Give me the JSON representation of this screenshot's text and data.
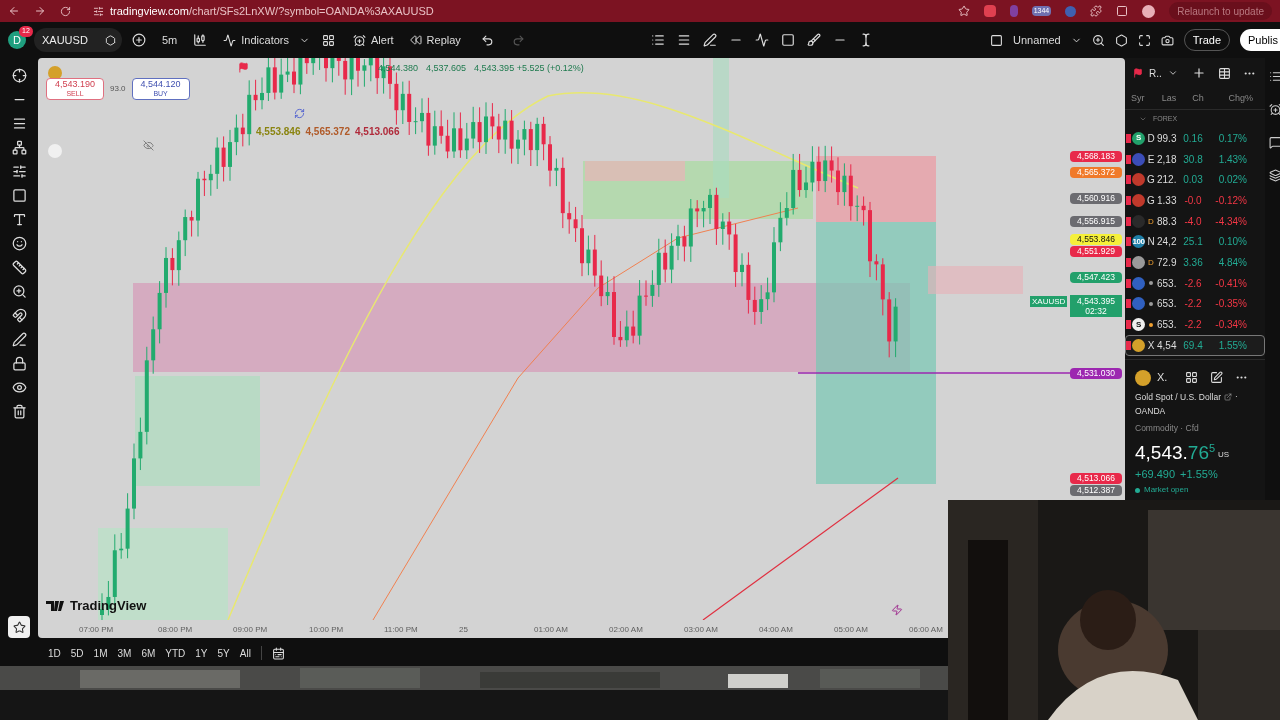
{
  "browser": {
    "url_host": "tradingview.com",
    "url_path": "/chart/SFs2LnXW/?symbol=OANDA%3AXAUUSD",
    "extension_badge": "1344",
    "relaunch": "Relaunch to update"
  },
  "toolbar": {
    "avatar": "D",
    "badge": "12",
    "symbol": "XAUUSD",
    "interval": "5m",
    "indicators": "Indicators",
    "alert": "Alert",
    "replay": "Replay",
    "layout": "Unnamed",
    "trade": "Trade",
    "publish": "Publis"
  },
  "chart": {
    "sell": {
      "price": "4,543.190",
      "label": "SELL"
    },
    "spread": "93.0",
    "buy": {
      "price": "4,544.120",
      "label": "BUY"
    },
    "ohlc": [
      "4,544.380",
      "4,537.605",
      "4,543.395 +5.525 (+0.12%)"
    ],
    "level_labels": [
      {
        "text": "4,553.846",
        "color": "#8a8410"
      },
      {
        "text": "4,565.372",
        "color": "#b05a28"
      },
      {
        "text": "4,513.066",
        "color": "#b02a3a"
      }
    ],
    "price_tags": [
      {
        "text": "4,568.183",
        "color": "#e8294a"
      },
      {
        "text": "4,565.372",
        "color": "#f07a2a"
      },
      {
        "text": "4,560.916",
        "color": "#6b6b70"
      },
      {
        "text": "4,556.915",
        "color": "#6b6b70"
      },
      {
        "text": "4,553.846",
        "color": "#f5f03a"
      },
      {
        "text": "4,551.929",
        "color": "#e8294a"
      },
      {
        "text": "4,547.423",
        "color": "#22a06b"
      },
      {
        "text": "4,531.030",
        "color": "#9c27b0"
      },
      {
        "text": "4,513.066",
        "color": "#e8294a"
      },
      {
        "text": "4,512.387",
        "color": "#6b6b70"
      }
    ],
    "current": {
      "symbol": "XAUUSD",
      "price": "4,543.395",
      "countdown": "02:32"
    },
    "time_axis": [
      "07:00 PM",
      "08:00 PM",
      "09:00 PM",
      "10:00 PM",
      "11:00 PM",
      "25",
      "01:00 AM",
      "02:00 AM",
      "03:00 AM",
      "04:00 AM",
      "05:00 AM",
      "06:00 AM"
    ],
    "watermark": "TradingView"
  },
  "ranges": [
    "1D",
    "5D",
    "1M",
    "3M",
    "6M",
    "YTD",
    "1Y",
    "5Y",
    "All"
  ],
  "watchlist": {
    "title": "R..",
    "columns": [
      "Syr",
      "Las",
      "Ch",
      "Chg%"
    ],
    "group": "FOREX",
    "rows": [
      {
        "icon_text": "S",
        "color": "#22a06b",
        "kind": "letter",
        "name": "D",
        "last": "99.3",
        "chg": "0.16",
        "chgp": "0.17%",
        "up": true,
        "selected": false
      },
      {
        "icon_text": "",
        "color": "#3b4db8",
        "kind": "letter",
        "name": "E",
        "last": "2,18",
        "chg": "30.8",
        "chgp": "1.43%",
        "up": true,
        "selected": false
      },
      {
        "icon_text": "",
        "color": "#c0392b",
        "kind": "letter",
        "name": "G",
        "last": "212.",
        "chg": "0.03",
        "chgp": "0.02%",
        "up": true,
        "selected": false
      },
      {
        "icon_text": "",
        "color": "#c0392b",
        "kind": "letter",
        "name": "G",
        "last": "1.33",
        "chg": "-0.0",
        "chgp": "-0.12%",
        "up": false,
        "selected": false
      },
      {
        "icon_text": "",
        "color": "#2a2a2a",
        "kind": "delayed",
        "name": "D",
        "last": "88.3",
        "chg": "-4.0",
        "chgp": "-4.34%",
        "up": false,
        "selected": false
      },
      {
        "icon_text": "100",
        "color": "#1f7fa8",
        "kind": "letter",
        "name": "N",
        "last": "24,2",
        "chg": "25.1",
        "chgp": "0.10%",
        "up": true,
        "selected": false
      },
      {
        "icon_text": "",
        "color": "#9a9a9a",
        "kind": "delayed",
        "name": "D",
        "last": "72.9",
        "chg": "3.36",
        "chgp": "4.84%",
        "up": true,
        "selected": false
      },
      {
        "icon_text": "",
        "color": "#3060c0",
        "kind": "dot",
        "marker": {
          "color": "#9a9a9a"
        },
        "last": "653.",
        "chg": "-2.6",
        "chgp": "-0.41%",
        "up": false,
        "selected": false
      },
      {
        "icon_text": "",
        "color": "#3060c0",
        "kind": "dot",
        "marker": {
          "color": "#9a9a9a"
        },
        "last": "653.",
        "chg": "-2.2",
        "chgp": "-0.35%",
        "up": false,
        "selected": false
      },
      {
        "icon_text": "S",
        "color": "#eeeeee",
        "kind": "dot",
        "marker": {
          "color": "#f0a030"
        },
        "last": "653.",
        "chg": "-2.2",
        "chgp": "-0.34%",
        "up": false,
        "selected": false
      },
      {
        "icon_text": "",
        "color": "#d4a02a",
        "kind": "letter",
        "name": "X",
        "last": "4,54",
        "chg": "69.4",
        "chgp": "1.55%",
        "up": true,
        "selected": true
      }
    ]
  },
  "details": {
    "symbol": "X.",
    "name": "Gold Spot / U.S. Dollar",
    "bullet": "·",
    "exchange": "OANDA",
    "category": "Commodity · Cfd",
    "price_main": "4,543.",
    "price_green": "76",
    "price_small": "5",
    "currency": "US",
    "change": "+69.490",
    "change_pct": "+1.55%",
    "status": "Market open"
  }
}
